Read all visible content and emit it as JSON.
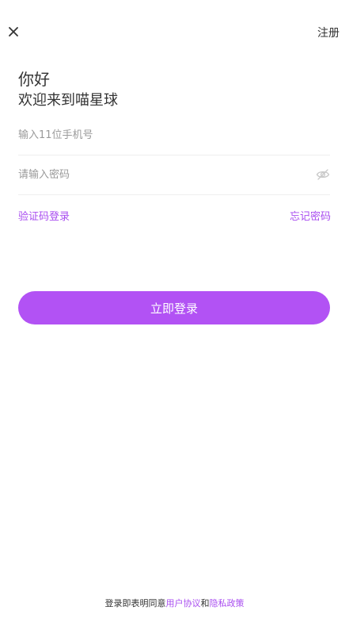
{
  "header": {
    "close_icon": "close-icon",
    "register_label": "注册"
  },
  "greeting": {
    "title": "你好",
    "subtitle": "欢迎来到喵星球"
  },
  "form": {
    "phone_placeholder": "输入11位手机号",
    "phone_value": "",
    "password_placeholder": "请输入密码",
    "password_value": "",
    "eye_icon": "eye-hidden-icon"
  },
  "links": {
    "code_login": "验证码登录",
    "forgot_password": "忘记密码"
  },
  "login_button": "立即登录",
  "agreement": {
    "prefix": "登录即表明同意",
    "user_agreement": "用户协议",
    "and": "和",
    "privacy_policy": "隐私政策"
  },
  "colors": {
    "accent": "#b252f4",
    "link": "#a94df0",
    "text": "#333333",
    "placeholder": "#9a9a9a"
  }
}
